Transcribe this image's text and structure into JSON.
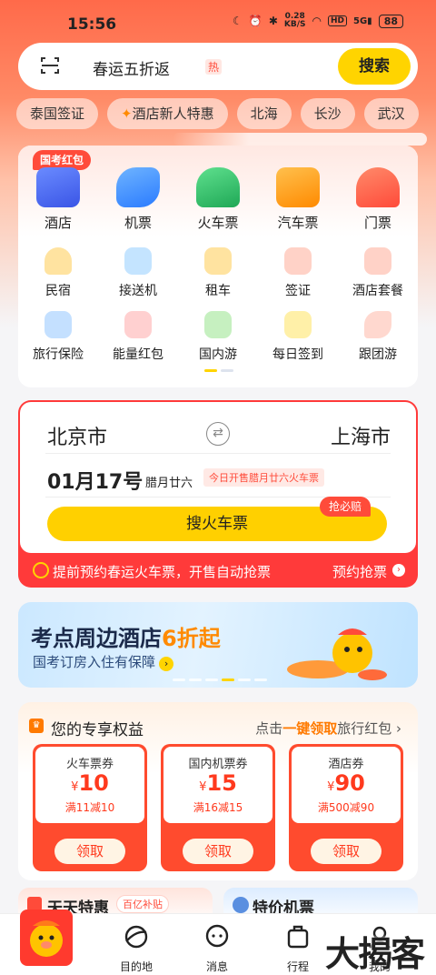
{
  "status_bar": {
    "time": "15:56",
    "speed_value": "0.28",
    "speed_unit": "KB/S",
    "hd": "HD",
    "signal": "5G",
    "battery": "88"
  },
  "search": {
    "text": "春运五折返",
    "hot_tag": "热",
    "button": "搜索"
  },
  "chips": [
    "泰国签证",
    "酒店新人特惠",
    "北海",
    "长沙",
    "武汉"
  ],
  "main_services": {
    "promo_tag": "国考红包",
    "big": [
      {
        "label": "酒店",
        "icon": "hotel-icon",
        "color": "#4a6cf7"
      },
      {
        "label": "机票",
        "icon": "plane-icon",
        "color": "#3a8bff"
      },
      {
        "label": "火车票",
        "icon": "train-icon",
        "color": "#2fbf6a"
      },
      {
        "label": "汽车票",
        "icon": "bus-icon",
        "color": "#ff9a1f"
      },
      {
        "label": "门票",
        "icon": "ticket-icon",
        "color": "#ff5a3a"
      }
    ],
    "small_row1": [
      {
        "label": "民宿",
        "icon": "homestay-icon",
        "color": "#ffd36b"
      },
      {
        "label": "接送机",
        "icon": "pickup-plane-icon",
        "color": "#9fd4ff"
      },
      {
        "label": "租车",
        "icon": "car-rental-icon",
        "color": "#ffd36b"
      },
      {
        "label": "签证",
        "icon": "visa-icon",
        "color": "#ffb3a3"
      },
      {
        "label": "酒店套餐",
        "icon": "hotel-package-icon",
        "color": "#ffb3a3"
      }
    ],
    "small_row2": [
      {
        "label": "旅行保险",
        "icon": "insurance-icon",
        "color": "#a8d4ff"
      },
      {
        "label": "能量红包",
        "icon": "red-packet-icon",
        "color": "#ffb3b3"
      },
      {
        "label": "国内游",
        "icon": "domestic-tour-icon",
        "color": "#a8e6a3"
      },
      {
        "label": "每日签到",
        "icon": "checkin-icon",
        "color": "#ffe07a"
      },
      {
        "label": "跟团游",
        "icon": "group-tour-icon",
        "color": "#ffc4b8"
      }
    ]
  },
  "train_search": {
    "from": "北京市",
    "to": "上海市",
    "date": "01月17号",
    "lunar": "腊月廿六",
    "sale_tip": "今日开售腊月廿六火车票",
    "grab_tag": "抢必赔",
    "button": "搜火车票",
    "banner_text": "提前预约春运火车票，开售自动抢票",
    "banner_link": "预约抢票"
  },
  "ad": {
    "title_main": "考点周边酒店",
    "title_highlight": "6折起",
    "subtitle": "国考订房入住有保障"
  },
  "rights": {
    "title": "您的专享权益",
    "link_prefix": "点击",
    "link_em": "一键领取",
    "link_suffix": "旅行红包",
    "coupons": [
      {
        "name": "火车票券",
        "currency": "¥",
        "value": "10",
        "cond": "满11减10",
        "button": "领取"
      },
      {
        "name": "国内机票券",
        "currency": "¥",
        "value": "15",
        "cond": "满16减15",
        "button": "领取"
      },
      {
        "name": "酒店券",
        "currency": "¥",
        "value": "90",
        "cond": "满500减90",
        "button": "领取"
      }
    ]
  },
  "bottom_cards": {
    "left_title": "天天特惠",
    "left_badge": "百亿补贴",
    "right_title": "特价机票"
  },
  "tabbar": {
    "tab1": "目的地",
    "tab2": "消息",
    "tab3": "行程",
    "tab4": "我的"
  },
  "watermark": "大揭客",
  "colors": {
    "brand_red": "#ff4b3a",
    "accent_yellow": "#ffd400",
    "highlight_orange": "#ff8a00"
  }
}
